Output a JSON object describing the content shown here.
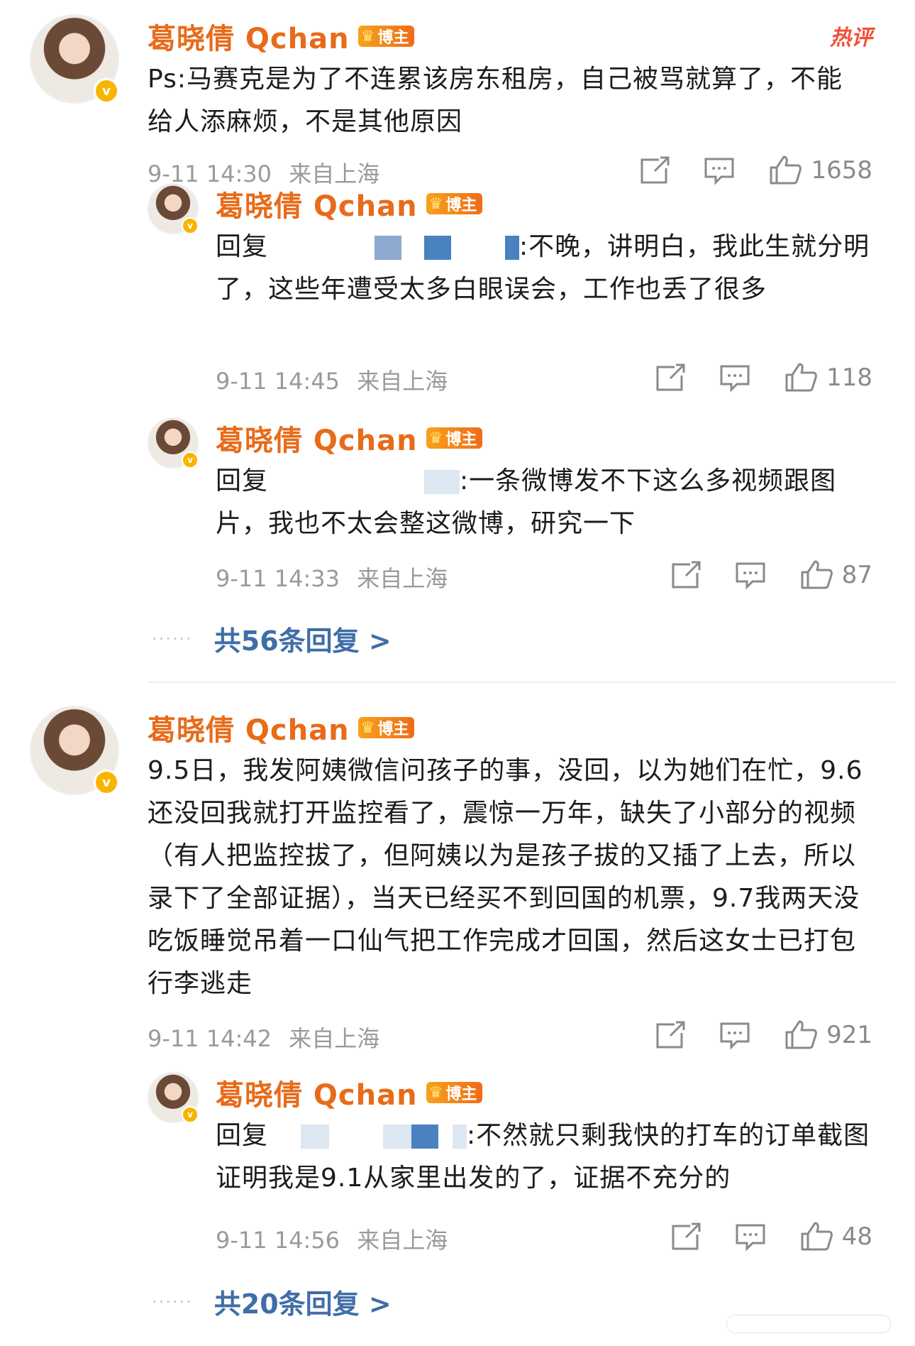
{
  "hot_tag": "热评",
  "comments": [
    {
      "name": "葛晓倩 Qchan",
      "badge": "博主",
      "text": "Ps:马赛克是为了不连累该房东租房，自己被骂就算了，不能给人添麻烦，不是其他原因",
      "time": "9-11 14:30",
      "location": "来自上海",
      "likes": "1658",
      "replies": [
        {
          "name": "葛晓倩 Qchan",
          "badge": "博主",
          "prefix": "回复",
          "text": ":不晚，讲明白，我此生就分明了，这些年遭受太多白眼误会，工作也丢了很多",
          "time": "9-11 14:45",
          "location": "来自上海",
          "likes": "118"
        },
        {
          "name": "葛晓倩 Qchan",
          "badge": "博主",
          "prefix": "回复",
          "text": ":一条微博发不下这么多视频跟图片，我也不太会整这微博，研究一下",
          "time": "9-11 14:33",
          "location": "来自上海",
          "likes": "87"
        }
      ],
      "more_replies": "共56条回复 >"
    },
    {
      "name": "葛晓倩 Qchan",
      "badge": "博主",
      "text": "9.5日，我发阿姨微信问孩子的事，没回，以为她们在忙，9.6还没回我就打开监控看了，震惊一万年，缺失了小部分的视频（有人把监控拔了，但阿姨以为是孩子拔的又插了上去，所以录下了全部证据），当天已经买不到回国的机票，9.7我两天没吃饭睡觉吊着一口仙气把工作完成才回国，然后这女士已打包行李逃走",
      "time": "9-11 14:42",
      "location": "来自上海",
      "likes": "921",
      "replies": [
        {
          "name": "葛晓倩 Qchan",
          "badge": "博主",
          "prefix": "回复",
          "text": ":不然就只剩我快的打车的订单截图证明我是9.1从家里出发的了，证据不充分的",
          "time": "9-11 14:56",
          "location": "来自上海",
          "likes": "48"
        }
      ],
      "more_replies": "共20条回复 >"
    }
  ]
}
